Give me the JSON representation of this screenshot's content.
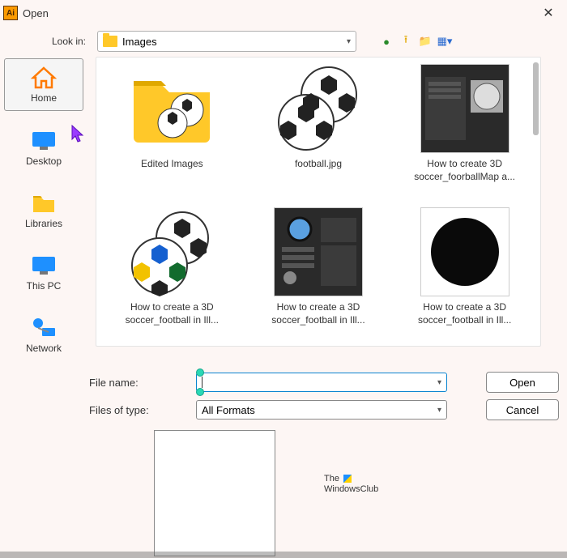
{
  "titlebar": {
    "title": "Open"
  },
  "lookin": {
    "label": "Look in:",
    "value": "Images"
  },
  "sidebar": {
    "items": [
      {
        "label": "Home",
        "selected": true
      },
      {
        "label": "Desktop"
      },
      {
        "label": "Libraries"
      },
      {
        "label": "This PC"
      },
      {
        "label": "Network"
      }
    ]
  },
  "files": {
    "items": [
      {
        "label": "Edited Images"
      },
      {
        "label": "football.jpg"
      },
      {
        "label": "How to create 3D soccer_foorballMap a..."
      },
      {
        "label": "How to create a 3D soccer_football in Ill..."
      },
      {
        "label": "How to create a 3D soccer_football in Ill..."
      },
      {
        "label": "How to create a 3D soccer_football in Ill..."
      }
    ]
  },
  "form": {
    "filename_label": "File name:",
    "filename_value": "",
    "type_label": "Files of type:",
    "type_value": "All Formats",
    "open": "Open",
    "cancel": "Cancel"
  },
  "watermark": {
    "line1": "The",
    "line2": "WindowsClub"
  }
}
